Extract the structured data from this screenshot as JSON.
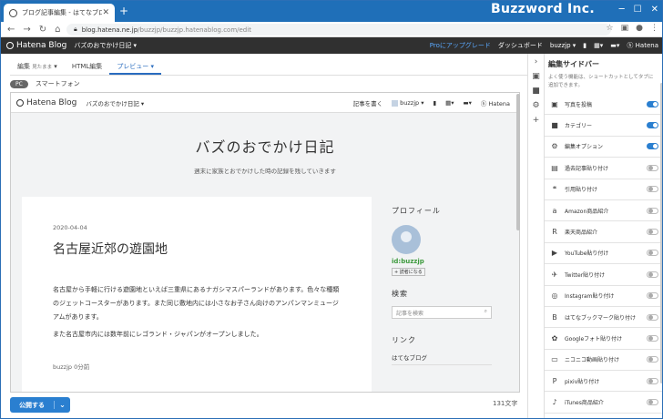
{
  "browser": {
    "tab_title": "ブログ記事編集 - はてなブログ",
    "url_host": "blog.hatena.ne.jp",
    "url_path": "/buzzjp/buzzjp.hatenablog.com/edit",
    "watermark": "Buzzword Inc."
  },
  "header": {
    "logo": "Hatena Blog",
    "blog_name": "バズのおでかけ日記",
    "pro": "Proにアップグレード",
    "dashboard": "ダッシュボード",
    "user": "buzzjp",
    "hatena": "Hatena"
  },
  "editor": {
    "tabs": [
      {
        "label": "編集",
        "sub": "見たまま"
      },
      {
        "label": "HTML編集"
      },
      {
        "label": "プレビュー"
      }
    ],
    "device_pc": "PC",
    "device_sp": "スマートフォン"
  },
  "preview": {
    "logo": "Hatena Blog",
    "blog_name": "バズのおでかけ日記",
    "write": "記事を書く",
    "user": "buzzjp",
    "hatena": "Hatena",
    "site_title": "バズのおでかけ日記",
    "site_sub": "週末に家族とおでかけした時の記録を残していきます",
    "article": {
      "date": "2020-04-04",
      "title": "名古屋近郊の遊園地",
      "p1": "名古屋から手軽に行ける遊園地といえば三重県にあるナガシマスパーランドがあります。色々な種類のジェットコースターがあります。また同じ敷地内には小さなお子さん向けのアンパンマンミュージアムがあります。",
      "p2": "また名古屋市内には数年前にレゴランド・ジャパンがオープンしました。",
      "author": "buzzjp 0分前"
    },
    "sidebar": {
      "profile": "プロフィール",
      "id": "id:buzzjp",
      "reader": "読者になる",
      "search": "検索",
      "search_ph": "記事を検索",
      "links": "リンク",
      "link1": "はてなブログ"
    }
  },
  "footer": {
    "publish": "公開する",
    "chars": "131文字"
  },
  "panel": {
    "title": "編集サイドバー",
    "desc": "よく使う機能は、ショートカットとしてタブに追加できます。",
    "items": [
      {
        "label": "写真を投稿",
        "icon": "photo-icon",
        "on": true
      },
      {
        "label": "カテゴリー",
        "icon": "folder-icon",
        "on": true
      },
      {
        "label": "編集オプション",
        "icon": "gear-icon",
        "on": true
      },
      {
        "label": "過去記事貼り付け",
        "icon": "document-icon",
        "on": false
      },
      {
        "label": "引用貼り付け",
        "icon": "quote-icon",
        "on": false
      },
      {
        "label": "Amazon商品紹介",
        "icon": "amazon-icon",
        "on": false
      },
      {
        "label": "楽天商品紹介",
        "icon": "rakuten-icon",
        "on": false
      },
      {
        "label": "YouTube貼り付け",
        "icon": "youtube-icon",
        "on": false
      },
      {
        "label": "Twitter貼り付け",
        "icon": "twitter-icon",
        "on": false
      },
      {
        "label": "Instagram貼り付け",
        "icon": "instagram-icon",
        "on": false
      },
      {
        "label": "はてなブックマーク貼り付け",
        "icon": "hatena-bookmark-icon",
        "on": false
      },
      {
        "label": "Googleフォト貼り付け",
        "icon": "google-photos-icon",
        "on": false
      },
      {
        "label": "ニコニコ動画貼り付け",
        "icon": "niconico-icon",
        "on": false
      },
      {
        "label": "pixiv貼り付け",
        "icon": "pixiv-icon",
        "on": false
      },
      {
        "label": "iTunes商品紹介",
        "icon": "music-icon",
        "on": false
      }
    ]
  }
}
